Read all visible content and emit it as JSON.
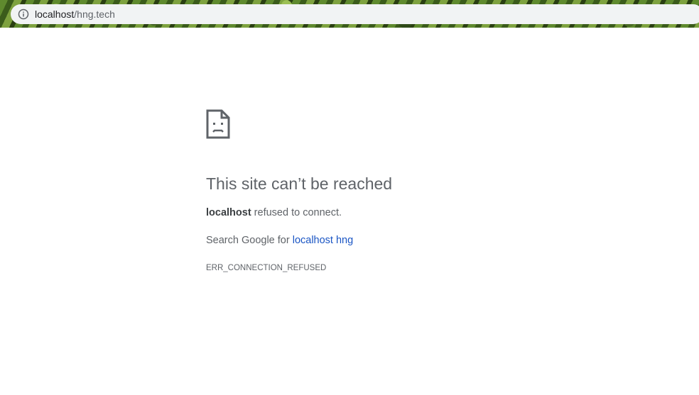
{
  "address_bar": {
    "icon": "info-icon",
    "url_host": "localhost",
    "url_path": "/hng.tech"
  },
  "error_page": {
    "icon": "sad-page-icon",
    "heading": "This site can’t be reached",
    "host": "localhost",
    "message": " refused to connect.",
    "search_prefix": "Search Google for ",
    "search_link": "localhost hng",
    "error_code": "ERR_CONNECTION_REFUSED"
  },
  "colors": {
    "text": "#5f6368",
    "link": "#1a55c4",
    "omnibox_bg": "#f1f3f4"
  }
}
